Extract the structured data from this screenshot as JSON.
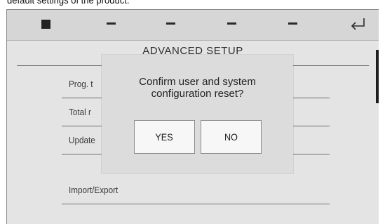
{
  "caption": "default settings of the product.",
  "toolbar": {
    "icons": [
      "stop-icon",
      "minus-icon",
      "minus-icon",
      "minus-icon",
      "minus-icon",
      "return-icon"
    ]
  },
  "screen": {
    "title": "ADVANCED SETUP",
    "menu": [
      {
        "label": "Prog. t"
      },
      {
        "label": "Total r"
      },
      {
        "label": "Update"
      },
      {
        "label": "Import/Export"
      }
    ]
  },
  "dialog": {
    "message_line1": "Confirm user and system",
    "message_line2": "configuration reset?",
    "yes_label": "YES",
    "no_label": "NO"
  },
  "colors": {
    "screen_bg": "#e4e4e4",
    "dialog_bg": "#dcdcdc",
    "button_bg": "#f7f7f7"
  }
}
